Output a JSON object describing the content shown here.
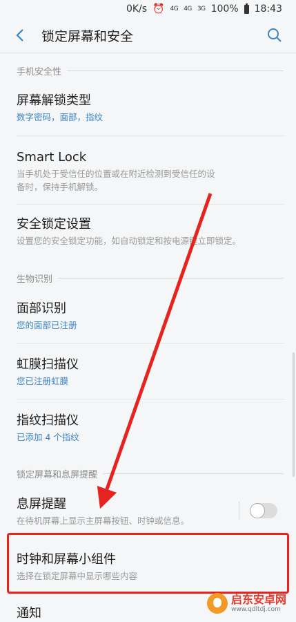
{
  "status_bar": {
    "speed": "0K/s",
    "net1": "4G",
    "net2": "4G",
    "net3": "3G",
    "battery": "100%",
    "time": "18:43"
  },
  "app_bar": {
    "title": "锁定屏幕和安全"
  },
  "sections": {
    "phone_security": "手机安全性",
    "biometrics": "生物识别",
    "lockscreen_aod": "锁定屏幕和息屏提醒"
  },
  "items": {
    "unlock_type": {
      "title": "屏幕解锁类型",
      "sub": "数字密码，面部，指纹"
    },
    "smart_lock": {
      "title": "Smart Lock",
      "sub_line1": "当手机处于受信任的位置或在附近检测到受信任的设",
      "sub_line2": "备时，保持手机解锁。"
    },
    "secure_lock": {
      "title": "安全锁定设置",
      "sub": "设置您的安全锁定功能，如自动锁定和按电源键立即锁定。"
    },
    "face": {
      "title": "面部识别",
      "sub": "您的面部已注册"
    },
    "iris": {
      "title": "虹膜扫描仪",
      "sub": "您已注册虹膜"
    },
    "fingerprint": {
      "title": "指纹扫描仪",
      "sub": "已添加 4 个指纹"
    },
    "aod": {
      "title": "息屏提醒",
      "sub": "在待机屏幕上显示主屏幕按钮、时钟或信息。",
      "enabled": false
    },
    "clock_widgets": {
      "title": "时钟和屏幕小组件",
      "sub": "选择在锁定屏幕中显示哪些内容"
    },
    "notifications": {
      "title": "通知"
    }
  },
  "watermark": {
    "name": "启东安卓网",
    "url": "www.qdltdj.com"
  },
  "colors": {
    "accent": "#3a84c4",
    "highlight": "#e5241f"
  }
}
